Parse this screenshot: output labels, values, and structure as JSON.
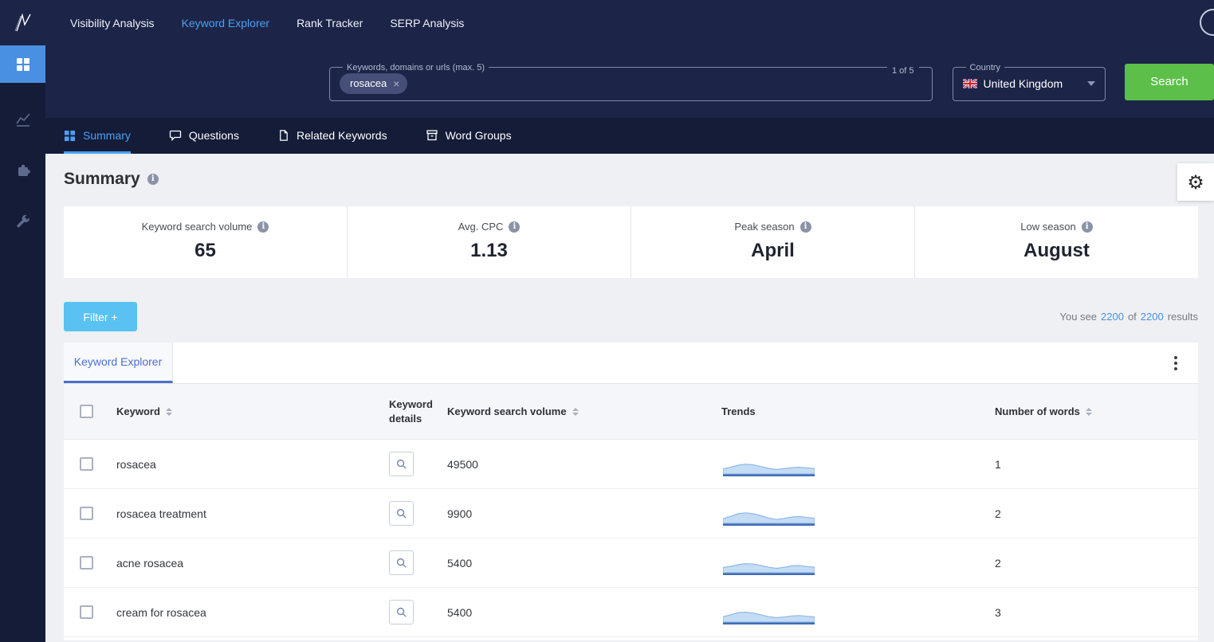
{
  "colors": {
    "navy": "#1c2547",
    "navy_dark": "#141c38",
    "accent_blue": "#4aa0f5",
    "link_blue": "#4a90e2",
    "search_green": "#5cbf4a",
    "filter_blue": "#59c2f2",
    "table_tab_blue": "#4a6fcf",
    "spark_fill": "#c5dcf5",
    "spark_stroke": "#8fb8e8",
    "spark_baseline": "#3f6cb5"
  },
  "icons": {
    "gear": "⚙",
    "close": "×"
  },
  "topnav": {
    "items": [
      {
        "label": "Visibility Analysis",
        "active": false
      },
      {
        "label": "Keyword Explorer",
        "active": true
      },
      {
        "label": "Rank Tracker",
        "active": false
      },
      {
        "label": "SERP Analysis",
        "active": false
      }
    ]
  },
  "searchbar": {
    "keywords_label": "Keywords, domains or urls (max. 5)",
    "chip": "rosacea",
    "counter": "1 of 5",
    "country_label": "Country",
    "country_value": "United Kingdom",
    "search_button": "Search"
  },
  "tabbar": {
    "tabs": [
      {
        "label": "Summary",
        "active": true
      },
      {
        "label": "Questions",
        "active": false
      },
      {
        "label": "Related Keywords",
        "active": false
      },
      {
        "label": "Word Groups",
        "active": false
      }
    ]
  },
  "summary": {
    "title": "Summary",
    "stats": [
      {
        "label": "Keyword search volume",
        "value": "65"
      },
      {
        "label": "Avg. CPC",
        "value": "1.13"
      },
      {
        "label": "Peak season",
        "value": "April"
      },
      {
        "label": "Low season",
        "value": "August"
      }
    ]
  },
  "filter_button": "Filter +",
  "results": {
    "you_see": "You see",
    "shown": "2200",
    "of": "of",
    "total": "2200",
    "results": "results"
  },
  "table": {
    "tab": "Keyword Explorer",
    "headers": {
      "keyword": "Keyword",
      "details": "Keyword details",
      "volume": "Keyword search volume",
      "trends": "Trends",
      "words": "Number of words"
    },
    "rows": [
      {
        "keyword": "rosacea",
        "volume": "49500",
        "words": "1",
        "trend": [
          28,
          38,
          50,
          56,
          52,
          42,
          32,
          26,
          30,
          36,
          38,
          34,
          31
        ]
      },
      {
        "keyword": "rosacea treatment",
        "volume": "9900",
        "words": "2",
        "trend": [
          26,
          40,
          55,
          60,
          54,
          43,
          30,
          22,
          28,
          36,
          39,
          33,
          29
        ]
      },
      {
        "keyword": "acne rosacea",
        "volume": "5400",
        "words": "2",
        "trend": [
          30,
          36,
          46,
          52,
          49,
          41,
          31,
          25,
          31,
          39,
          41,
          35,
          31
        ]
      },
      {
        "keyword": "cream for rosacea",
        "volume": "5400",
        "words": "3",
        "trend": [
          30,
          42,
          54,
          57,
          51,
          41,
          31,
          25,
          29,
          35,
          37,
          33,
          29
        ]
      }
    ]
  }
}
